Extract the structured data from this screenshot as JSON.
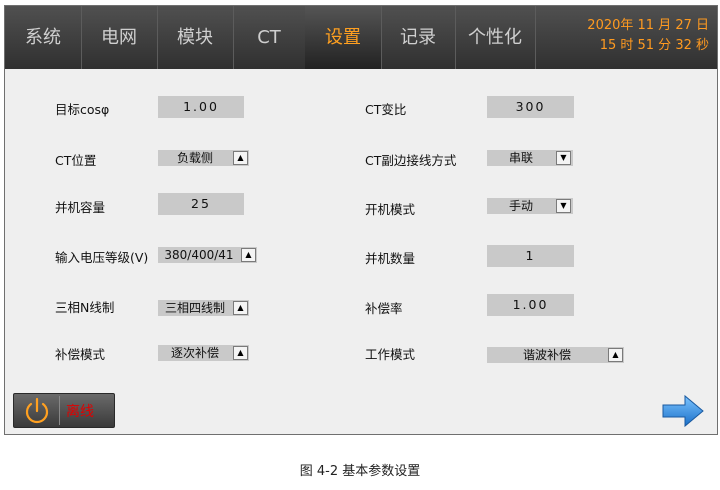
{
  "tabs": [
    {
      "label": "系统",
      "active": false
    },
    {
      "label": "电网",
      "active": false
    },
    {
      "label": "模块",
      "active": false
    },
    {
      "label": "CT",
      "active": false
    },
    {
      "label": "设置",
      "active": true
    },
    {
      "label": "记录",
      "active": false
    },
    {
      "label": "个性化",
      "active": false
    }
  ],
  "clock": {
    "date": "2020年 11 月 27 日",
    "time": "15 时 51 分 32 秒"
  },
  "left": {
    "target_cos": {
      "label": "目标cosφ",
      "value": "1.00"
    },
    "ct_position": {
      "label": "CT位置",
      "value": "负载侧"
    },
    "parallel_capacity": {
      "label": "并机容量",
      "value": "25"
    },
    "input_voltage": {
      "label": "输入电压等级(V)",
      "value": "380/400/41"
    },
    "three_phase": {
      "label": "三相N线制",
      "value": "三相四线制"
    },
    "compensation_mode": {
      "label": "补偿模式",
      "value": "逐次补偿"
    }
  },
  "right": {
    "ct_ratio": {
      "label": "CT变比",
      "value": "300"
    },
    "ct_secondary": {
      "label": "CT副边接线方式",
      "value": "串联"
    },
    "startup_mode": {
      "label": "开机模式",
      "value": "手动"
    },
    "parallel_count": {
      "label": "并机数量",
      "value": "1"
    },
    "compensation_rate": {
      "label": "补偿率",
      "value": "1.00"
    },
    "work_mode": {
      "label": "工作模式",
      "value": "谐波补偿"
    }
  },
  "status": {
    "offline": "离线"
  },
  "caption": "图 4-2  基本参数设置",
  "colors": {
    "accent": "#ffa020",
    "offline": "#e00000",
    "next_arrow": "#2a86d8"
  },
  "icons": {
    "power": "power-icon",
    "next": "arrow-right-icon",
    "dropdown": "triangle-up-icon"
  }
}
